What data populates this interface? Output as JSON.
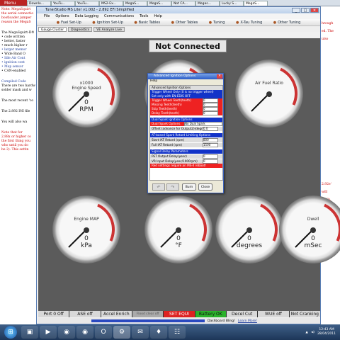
{
  "browser": {
    "menu_label": "Menu",
    "tabs": [
      "Downlo...",
      "YouTu...",
      "YouTu...",
      "MS2-Ex...",
      "MegaS...",
      "MegaS...",
      "Not CA...",
      "Megas...",
      "Lucky S...",
      "MegaS..."
    ]
  },
  "bg_page": {
    "left_lines": [
      {
        "text": "Note: MegaSquirt",
        "style": "red"
      },
      {
        "text": "the serial connectio",
        "style": "red"
      },
      {
        "text": "bootloader jumper",
        "style": "red"
      },
      {
        "text": "reason the MegaS",
        "style": "red"
      },
      {
        "text": "The MegaSquirt-II®",
        "style": "normal"
      },
      {
        "text": "• code written",
        "style": "normal"
      },
      {
        "text": "• better, faster",
        "style": "normal"
      },
      {
        "text": "• much higher r",
        "style": "normal"
      },
      {
        "text": "• larger memor",
        "style": "blue"
      },
      {
        "text": "• Wide Band O",
        "style": "normal"
      },
      {
        "text": "• Idle Air Cont",
        "style": "blue"
      },
      {
        "text": "• ignition cont",
        "style": "blue"
      },
      {
        "text": "• Map sensor",
        "style": "blue"
      },
      {
        "text": "• CAN-enabled",
        "style": "normal"
      },
      {
        "text": "Compiled Code",
        "style": "blue"
      },
      {
        "text": "There are two hardw",
        "style": "normal"
      },
      {
        "text": "solder mask and w",
        "style": "normal"
      },
      {
        "text": "The most recent 'co",
        "style": "normal"
      },
      {
        "text": "The 2.892 INI file",
        "style": "normal"
      },
      {
        "text": "You will also wa",
        "style": "normal"
      },
      {
        "text": "Note that for",
        "style": "red"
      },
      {
        "text": "2.88x or higher co",
        "style": "red"
      },
      {
        "text": "the first thing you",
        "style": "red"
      },
      {
        "text": "who until you do",
        "style": "red"
      },
      {
        "text": "be 2). This settin",
        "style": "red"
      }
    ],
    "right_lines": [
      "hrough",
      "ed. The",
      "ulso",
      "2.92e'",
      "will",
      "Be 2)."
    ]
  },
  "app": {
    "title": "TunerStudio MS Lite! v1.002 - 2.892 EFI Simplified",
    "menus": [
      "File",
      "Options",
      "Data Logging",
      "Communications",
      "Tools",
      "Help"
    ],
    "toolbar": [
      {
        "icon": "fuel-icon",
        "label": "Fuel Set-Up"
      },
      {
        "icon": "spark-icon",
        "label": "Ignition Set-Up"
      },
      {
        "icon": "table-icon",
        "label": "Basic Tables"
      },
      {
        "icon": "table-icon",
        "label": "Other Tables"
      },
      {
        "icon": "wrench-icon",
        "label": "Tuning"
      },
      {
        "icon": "wrench-icon",
        "label": "X-Tau Tuning"
      },
      {
        "icon": "wrench-icon",
        "label": "Other Tuning"
      }
    ],
    "subtabs": [
      "Gauge Cluster",
      "Diagnostics",
      "VE Analyze Live"
    ],
    "banner": "Not Connected"
  },
  "gauges": [
    {
      "label": "Engine Speed",
      "sublabel": "x1000",
      "value": "0",
      "unit": "RPM"
    },
    {
      "label": "",
      "sublabel": "",
      "value": "",
      "unit": ""
    },
    {
      "label": "Air Fuel Ratio",
      "sublabel": "",
      "value": "",
      "unit": ""
    },
    {
      "label": "Engine MAP",
      "sublabel": "",
      "value": "0",
      "unit": "kPa"
    },
    {
      "label": "",
      "sublabel": "",
      "value": "0",
      "unit": "°F"
    },
    {
      "label": "",
      "sublabel": "",
      "value": "0",
      "unit": "degrees"
    },
    {
      "label": "Dwell",
      "sublabel": "",
      "value": "0",
      "unit": "mSec"
    }
  ],
  "indicators": [
    {
      "label": "Port 0 Off",
      "state": "off"
    },
    {
      "label": "ASE off",
      "state": "off"
    },
    {
      "label": "Accel Enrich",
      "state": "off"
    },
    {
      "label": "Flood clear off",
      "state": "gray"
    },
    {
      "label": "SET EQUI",
      "state": "red"
    },
    {
      "label": "Battery OK",
      "state": "green"
    },
    {
      "label": "Decel Cut",
      "state": "off"
    },
    {
      "label": "WUE off",
      "state": "off"
    },
    {
      "label": "Not Cranking",
      "state": "off"
    }
  ],
  "statusbar": {
    "dashboard": "Dashboard Bling!",
    "learn": "Learn More!"
  },
  "dialog": {
    "title": "Advanced Ignition Options",
    "help_menu": "Help",
    "rows": [
      {
        "text": "Advanced Ignition Options",
        "style": "hdr"
      },
      {
        "text": "Trigger Wheel Only (0 is no trigger wheel)",
        "style": "blue"
      },
      {
        "text": "Set only with EN-EDIS OFF",
        "style": "blue"
      },
      {
        "text": "Trigger Wheel Teeth(teeth)",
        "style": "red",
        "field": "0"
      },
      {
        "text": "Missing Teeth(teeth)",
        "style": "red",
        "field": "0"
      },
      {
        "text": "Skip Teeth(teeth)",
        "style": "red",
        "field": "0"
      },
      {
        "text": "Delay Teeth(teeth)",
        "style": "red",
        "field": "0"
      },
      {
        "text": "Dual Spark Ignition Options",
        "style": "blue"
      },
      {
        "text": "Dual Spark Options",
        "style": "red",
        "select": "No Dual Spark"
      },
      {
        "text": "Offset (advance for Output2)(degrees)",
        "style": "hdr",
        "field": "0.0"
      },
      {
        "text": "AT-based Spark Retard Limiting Options",
        "style": "blue"
      },
      {
        "text": "Start IAT Retard (rpm)",
        "style": "hdr",
        "field": "800"
      },
      {
        "text": "Full IAT Retard (rpm)",
        "style": "hdr",
        "field": "1500"
      },
      {
        "text": "Signal Delay Parameters",
        "style": "blue"
      },
      {
        "text": "PET Output Delay(µsec)",
        "style": "hdr",
        "field": "0"
      },
      {
        "text": "VR Input Delay(µsec/1000rpm)",
        "style": "hdr",
        "field": "0"
      },
      {
        "text": "Red settings require an MS-II reboot!",
        "style": "red"
      }
    ],
    "buttons": {
      "burn": "Burn",
      "close": "Close"
    }
  },
  "taskbar": {
    "apps": [
      "▣",
      "▶",
      "◉",
      "◉",
      "O",
      "⚙",
      "✉",
      "♦",
      "☷"
    ],
    "time": "12:43 AM",
    "date": "28/04/2011"
  }
}
